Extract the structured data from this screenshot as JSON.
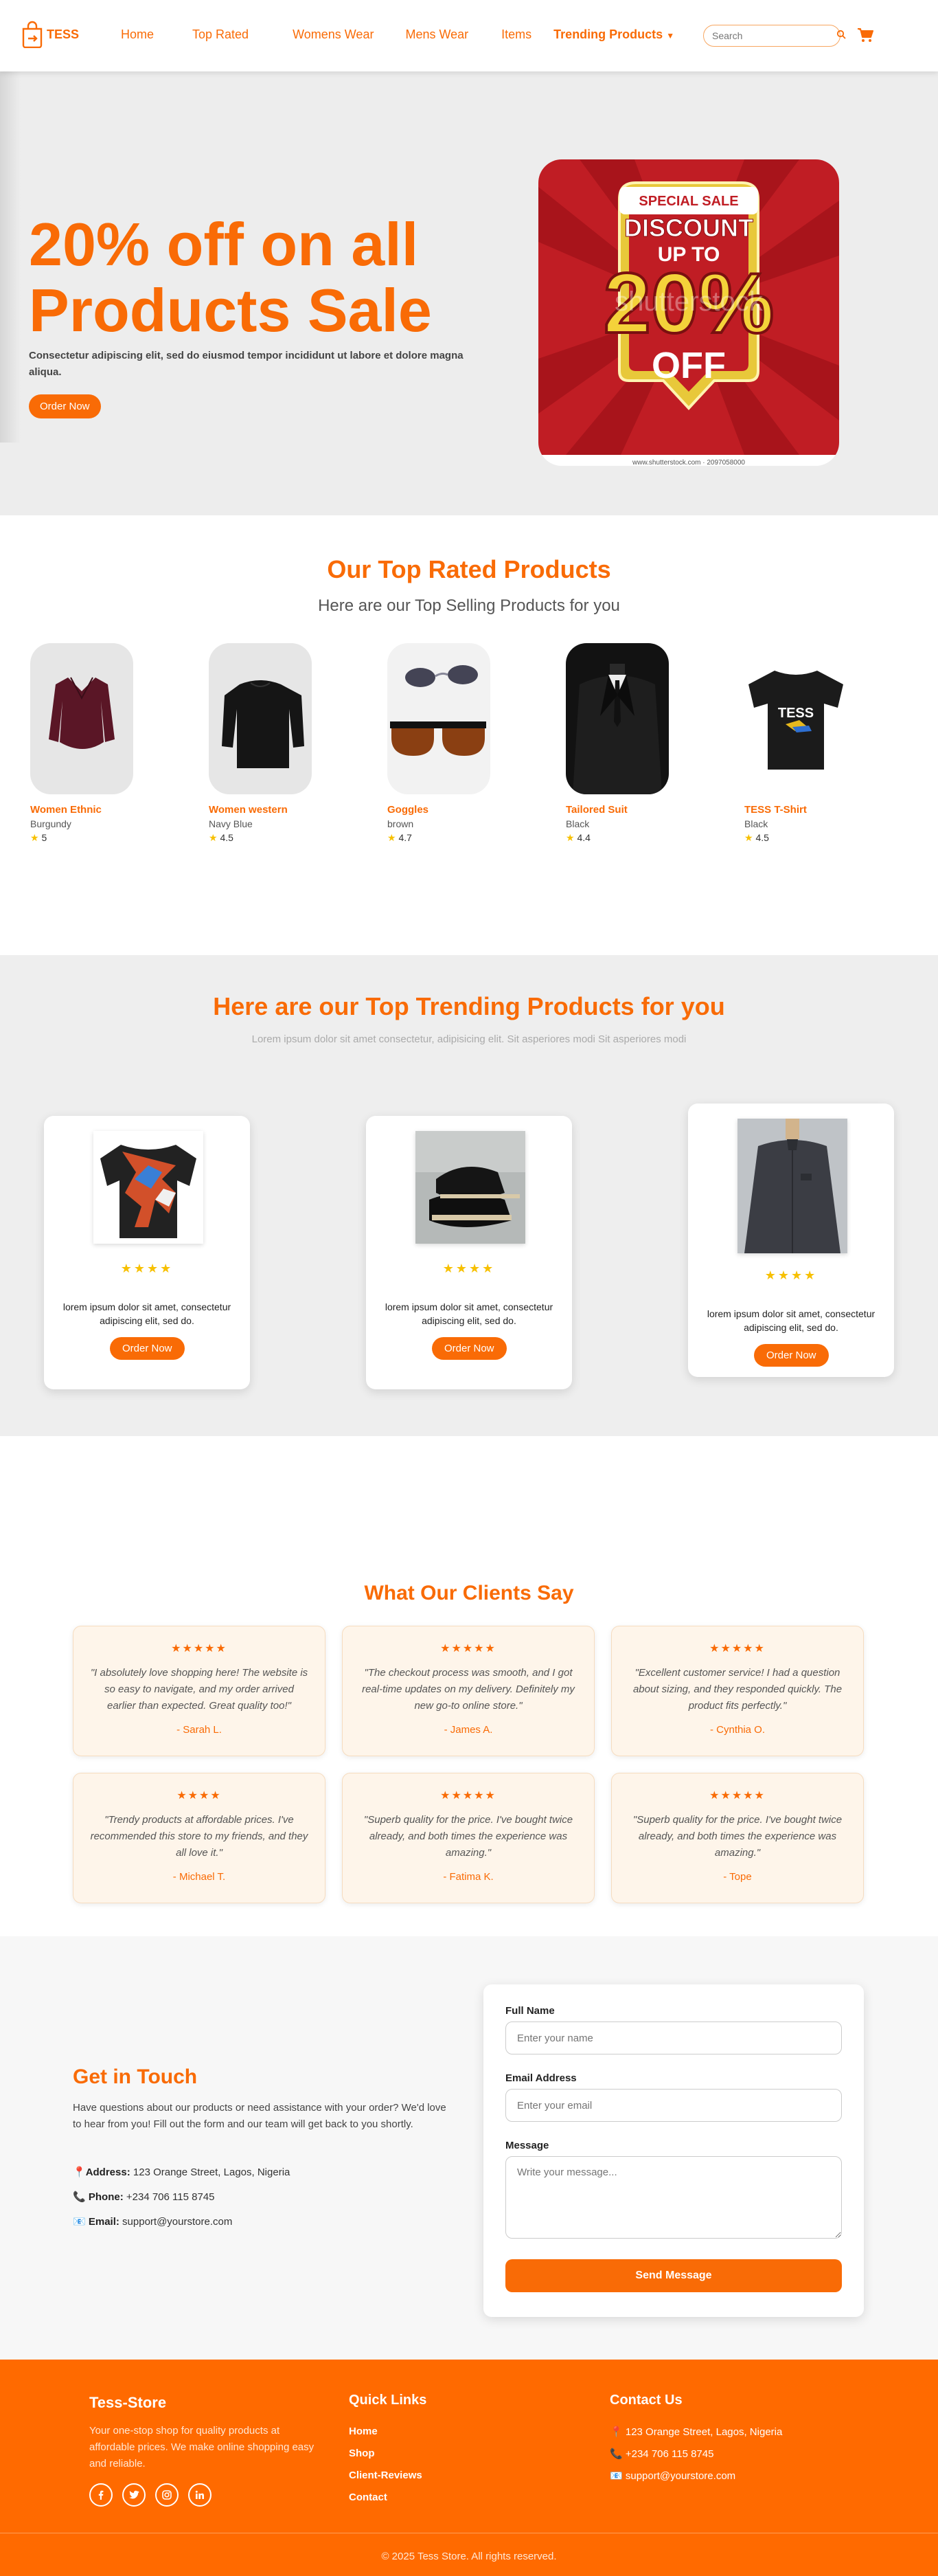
{
  "header": {
    "logo_text": "TESS",
    "nav": [
      "Home",
      "Top Rated",
      "Womens Wear",
      "Mens Wear",
      "Items",
      "Trending Products"
    ],
    "search_placeholder": "Search"
  },
  "hero": {
    "title": "20% off on all Products Sale",
    "desc": "Consectetur adipiscing elit, sed do eiusmod tempor incididunt ut labore et dolore magna aliqua.",
    "cta": "Order Now",
    "promo": {
      "line1": "SPECIAL SALE",
      "line2": "DISCOUNT",
      "line3": "UP TO",
      "line4": "20%",
      "line5": "OFF",
      "watermark": "shutterstock",
      "caption": "www.shutterstock.com · 2097058000"
    }
  },
  "top_rated": {
    "title": "Our Top Rated Products",
    "subtitle": "Here are our Top Selling Products for you",
    "products": [
      {
        "name": "Women Ethnic",
        "color": "Burgundy",
        "rating": "5"
      },
      {
        "name": "Women western",
        "color": "Navy Blue",
        "rating": "4.5"
      },
      {
        "name": "Goggles",
        "color": "brown",
        "rating": "4.7"
      },
      {
        "name": "Tailored Suit",
        "color": "Black",
        "rating": "4.4"
      },
      {
        "name": "TESS T-Shirt",
        "color": "Black",
        "rating": "4.5",
        "print": "TESS"
      }
    ]
  },
  "trending": {
    "title": "Here are our Top Trending Products for you",
    "subtitle": "Lorem ipsum dolor sit amet consectetur, adipisicing elit. Sit asperiores modi Sit asperiores modi",
    "cards": [
      {
        "stars": "★★★★",
        "text": "lorem ipsum dolor sit amet, consectetur adipiscing elit, sed do.",
        "cta": "Order Now"
      },
      {
        "stars": "★★★★",
        "text": "lorem ipsum dolor sit amet, consectetur adipiscing elit, sed do.",
        "cta": "Order Now"
      },
      {
        "stars": "★★★★",
        "text": "lorem ipsum dolor sit amet, consectetur adipiscing elit, sed do.",
        "cta": "Order Now"
      }
    ]
  },
  "testimonials": {
    "title": "What Our Clients Say",
    "items": [
      {
        "stars": "★★★★★",
        "quote": "\"I absolutely love shopping here! The website is so easy to navigate, and my order arrived earlier than expected. Great quality too!\"",
        "author": "- Sarah L."
      },
      {
        "stars": "★★★★★",
        "quote": "\"The checkout process was smooth, and I got real-time updates on my delivery. Definitely my new go-to online store.\"",
        "author": "- James A."
      },
      {
        "stars": "★★★★★",
        "quote": "\"Excellent customer service! I had a question about sizing, and they responded quickly. The product fits perfectly.\"",
        "author": "- Cynthia O."
      },
      {
        "stars": "★★★★",
        "quote": "\"Trendy products at affordable prices. I've recommended this store to my friends, and they all love it.\"",
        "author": "- Michael T."
      },
      {
        "stars": "★★★★★",
        "quote": "\"Superb quality for the price. I've bought twice already, and both times the experience was amazing.\"",
        "author": "- Fatima K."
      },
      {
        "stars": "★★★★★",
        "quote": "\"Superb quality for the price. I've bought twice already, and both times the experience was amazing.\"",
        "author": "- Tope"
      }
    ]
  },
  "contact": {
    "title": "Get in Touch",
    "intro": "Have questions about our products or need assistance with your order? We'd love to hear from you! Fill out the form and our team will get back to you shortly.",
    "address_label": "Address:",
    "address": "123 Orange Street, Lagos, Nigeria",
    "phone_label": "Phone:",
    "phone": "+234 706 115 8745",
    "email_label": "Email:",
    "email": "support@yourstore.com",
    "form": {
      "name_label": "Full Name",
      "name_placeholder": "Enter your name",
      "email_label": "Email Address",
      "email_placeholder": "Enter your email",
      "message_label": "Message",
      "message_placeholder": "Write your message...",
      "submit": "Send Message"
    }
  },
  "footer": {
    "brand": "Tess-Store",
    "desc": "Your one-stop shop for quality products at affordable prices. We make online shopping easy and reliable.",
    "links_title": "Quick Links",
    "links": [
      "Home",
      "Shop",
      "Client-Reviews",
      "Contact"
    ],
    "contact_title": "Contact Us",
    "address": "123 Orange Street, Lagos, Nigeria",
    "phone": "+234 706 115 8745",
    "email": "support@yourstore.com",
    "copyright": "© 2025 Tess Store. All rights reserved.",
    "social": [
      "facebook-icon",
      "twitter-icon",
      "instagram-icon",
      "linkedin-icon"
    ]
  },
  "colors": {
    "accent": "#f96b06",
    "footer": "#ff6a00",
    "star": "#f7c000"
  }
}
